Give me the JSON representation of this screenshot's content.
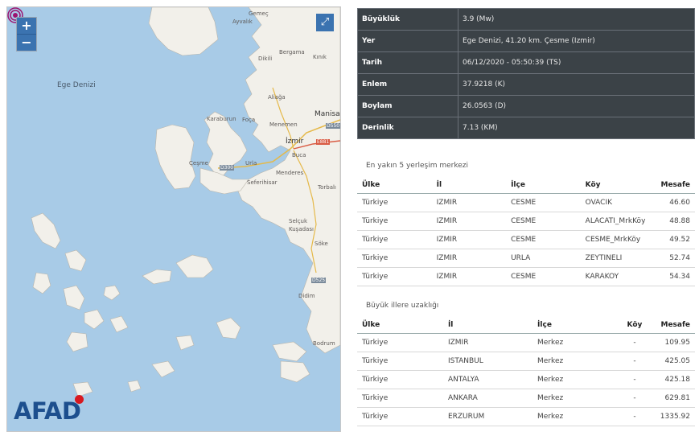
{
  "map": {
    "zoom_in": "+",
    "zoom_out": "−",
    "fullscreen": "⤢",
    "logo": "AFAD",
    "sea_label": "Ege Denizi",
    "places": [
      {
        "name": "Gemeç"
      },
      {
        "name": "Ayvalık"
      },
      {
        "name": "Bergama"
      },
      {
        "name": "Kınık"
      },
      {
        "name": "Dikili"
      },
      {
        "name": "Aliağa"
      },
      {
        "name": "Manisa"
      },
      {
        "name": "Karaburun"
      },
      {
        "name": "Foça"
      },
      {
        "name": "Menemen"
      },
      {
        "name": "İzmir"
      },
      {
        "name": "Buca"
      },
      {
        "name": "Çeşme"
      },
      {
        "name": "Urla"
      },
      {
        "name": "Menderes"
      },
      {
        "name": "Seferihisar"
      },
      {
        "name": "Torbalı"
      },
      {
        "name": "Selçuk"
      },
      {
        "name": "Kuşadası"
      },
      {
        "name": "Söke"
      },
      {
        "name": "Didim"
      },
      {
        "name": "Bodrum"
      }
    ],
    "roads": [
      "D300",
      "D550",
      "E881",
      "D525"
    ]
  },
  "info": {
    "rows": [
      {
        "key": "Büyüklük",
        "value": "3.9 (Mw)"
      },
      {
        "key": "Yer",
        "value": "Ege Denizi, 41.20 km. Çesme (Izmir)"
      },
      {
        "key": "Tarih",
        "value": "06/12/2020 - 05:50:39 (TS)"
      },
      {
        "key": "Enlem",
        "value": "37.9218 (K)"
      },
      {
        "key": "Boylam",
        "value": "26.0563 (D)"
      },
      {
        "key": "Derinlik",
        "value": "7.13 (KM)"
      }
    ]
  },
  "nearest": {
    "title": "En yakın 5 yerleşim merkezi",
    "headers": {
      "country": "Ülke",
      "province": "İl",
      "district": "İlçe",
      "village": "Köy",
      "distance": "Mesafe"
    },
    "rows": [
      {
        "country": "Türkiye",
        "province": "IZMIR",
        "district": "CESME",
        "village": "OVACIK",
        "distance": "46.60"
      },
      {
        "country": "Türkiye",
        "province": "IZMIR",
        "district": "CESME",
        "village": "ALACATI_MrkKöy",
        "distance": "48.88"
      },
      {
        "country": "Türkiye",
        "province": "IZMIR",
        "district": "CESME",
        "village": "CESME_MrkKöy",
        "distance": "49.52"
      },
      {
        "country": "Türkiye",
        "province": "IZMIR",
        "district": "URLA",
        "village": "ZEYTINELI",
        "distance": "52.74"
      },
      {
        "country": "Türkiye",
        "province": "IZMIR",
        "district": "CESME",
        "village": "KARAKOY",
        "distance": "54.34"
      }
    ]
  },
  "cities": {
    "title": "Büyük illere uzaklığı",
    "headers": {
      "country": "Ülke",
      "province": "İl",
      "district": "İlçe",
      "village": "Köy",
      "distance": "Mesafe"
    },
    "rows": [
      {
        "country": "Türkiye",
        "province": "IZMIR",
        "district": "Merkez",
        "village": "-",
        "distance": "109.95"
      },
      {
        "country": "Türkiye",
        "province": "ISTANBUL",
        "district": "Merkez",
        "village": "-",
        "distance": "425.05"
      },
      {
        "country": "Türkiye",
        "province": "ANTALYA",
        "district": "Merkez",
        "village": "-",
        "distance": "425.18"
      },
      {
        "country": "Türkiye",
        "province": "ANKARA",
        "district": "Merkez",
        "village": "-",
        "distance": "629.81"
      },
      {
        "country": "Türkiye",
        "province": "ERZURUM",
        "district": "Merkez",
        "village": "-",
        "distance": "1335.92"
      }
    ]
  },
  "colors": {
    "sea": "#a8cbe7",
    "land": "#f2f0ea",
    "header_bg": "#3b4247",
    "epicenter": "#9c1470",
    "logo": "#1d4f8e"
  }
}
